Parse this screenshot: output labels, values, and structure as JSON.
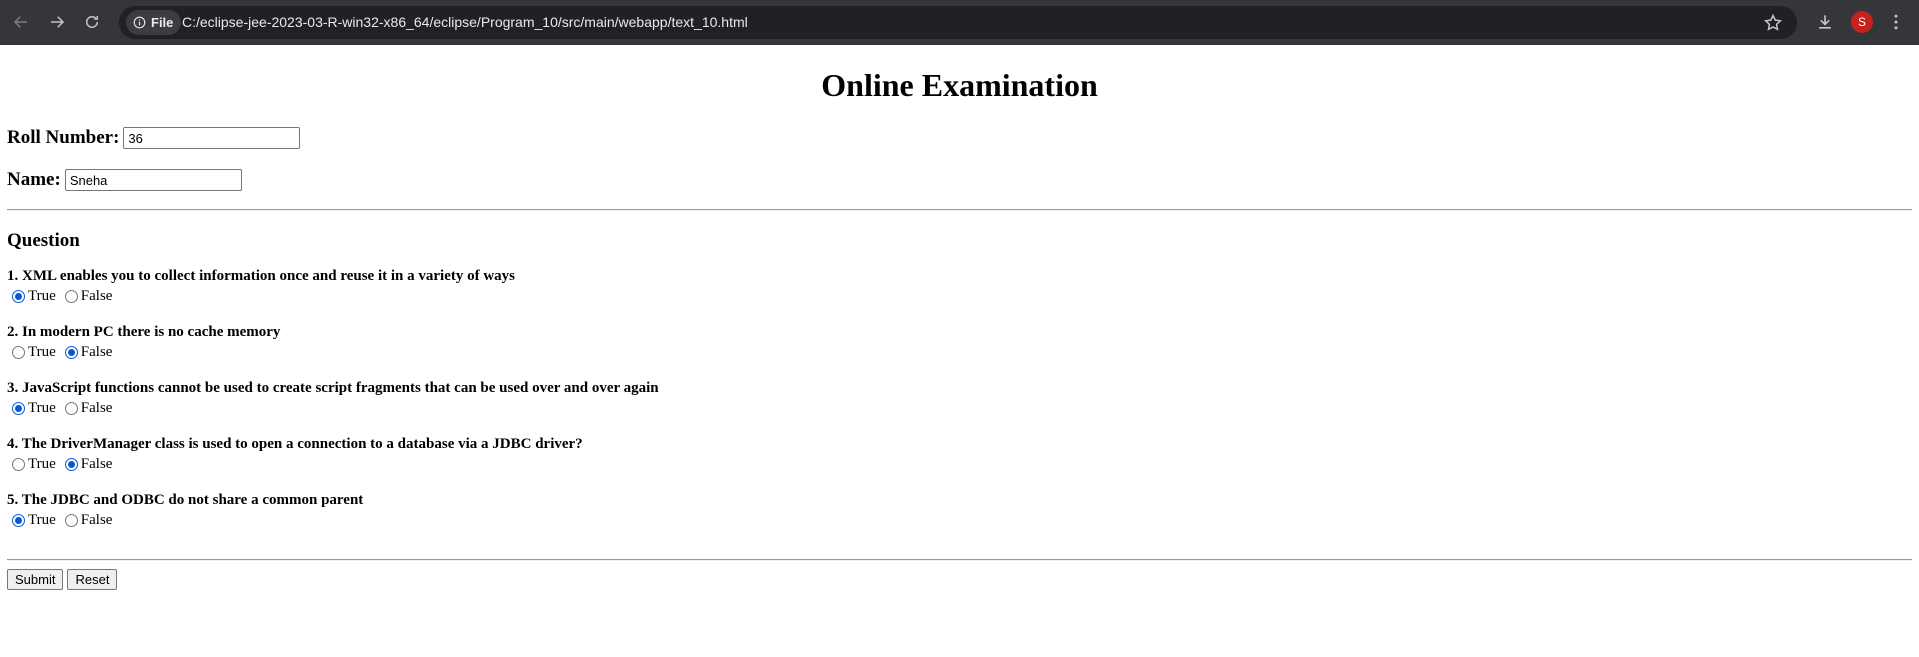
{
  "browser": {
    "chip_label": "File",
    "url": "C:/eclipse-jee-2023-03-R-win32-x86_64/eclipse/Program_10/src/main/webapp/text_10.html",
    "avatar_letter": "S",
    "avatar_color": "#c5221f",
    "icons": [
      "back-arrow-icon",
      "forward-arrow-icon",
      "reload-icon",
      "info-icon",
      "star-icon",
      "download-icon",
      "kebab-menu-icon"
    ]
  },
  "page": {
    "title": "Online Examination",
    "roll_label": "Roll Number:",
    "roll_value": "36",
    "name_label": "Name:",
    "name_value": "Sneha",
    "section_heading": "Question",
    "true_label": "True",
    "false_label": "False",
    "accent_color": "#0b57d0",
    "questions": [
      {
        "text": "1. XML enables you to collect information once and reuse it in a variety of ways",
        "selected": "True"
      },
      {
        "text": "2. In modern PC there is no cache memory",
        "selected": "False"
      },
      {
        "text": "3. JavaScript functions cannot be used to create script fragments that can be used over and over again",
        "selected": "True"
      },
      {
        "text": "4. The DriverManager class is used to open a connection to a database via a JDBC driver?",
        "selected": "False"
      },
      {
        "text": "5. The JDBC and ODBC do not share a common parent",
        "selected": "True"
      }
    ],
    "submit_label": "Submit",
    "reset_label": "Reset"
  }
}
